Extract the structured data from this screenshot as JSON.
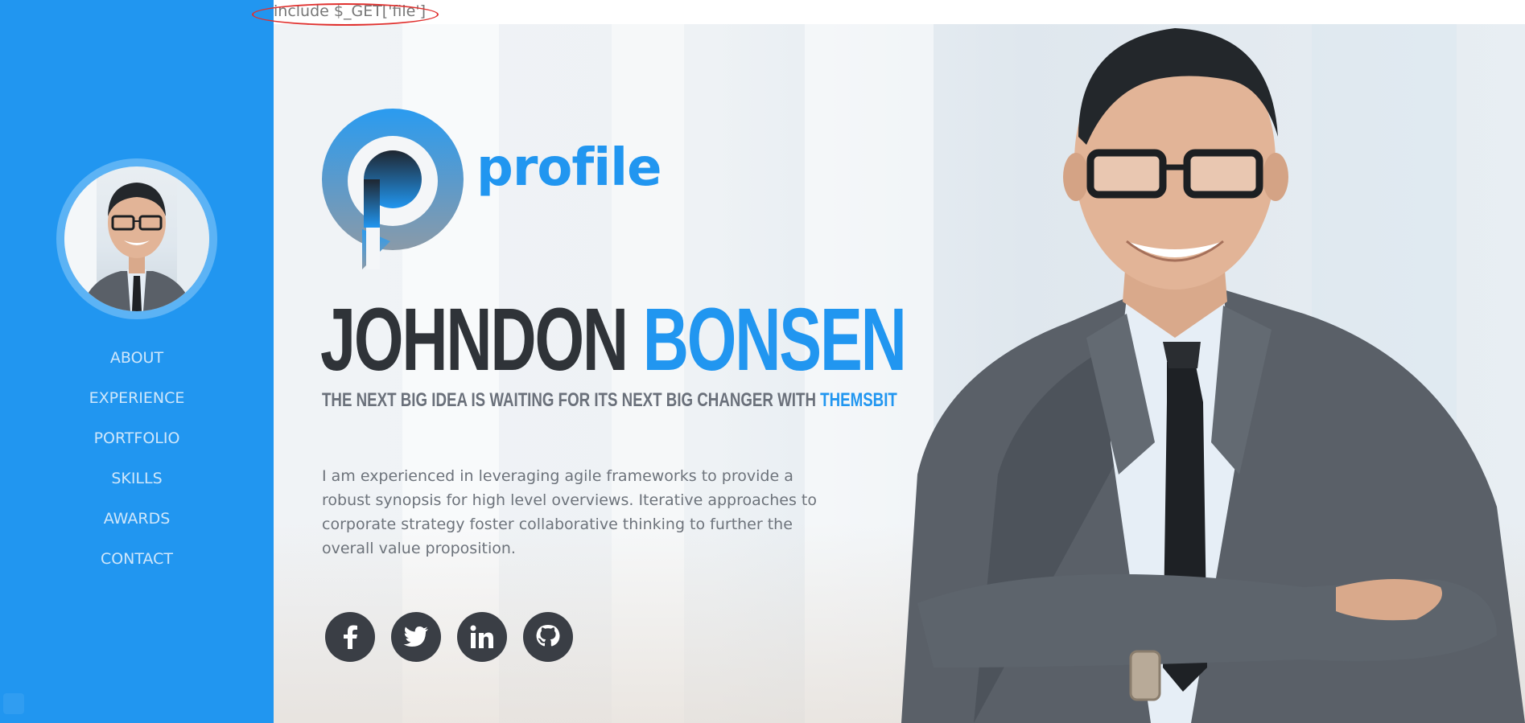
{
  "topbar": {
    "code_text": "include $_GET['file']"
  },
  "sidebar": {
    "nav": [
      {
        "label": "ABOUT"
      },
      {
        "label": "EXPERIENCE"
      },
      {
        "label": "PORTFOLIO"
      },
      {
        "label": "SKILLS"
      },
      {
        "label": "AWARDS"
      },
      {
        "label": "CONTACT"
      }
    ]
  },
  "hero": {
    "logo_word": "profile",
    "name_first": "JOHNDON",
    "name_last": "BONSEN",
    "tagline_prefix": "THE NEXT BIG IDEA IS WAITING FOR ITS NEXT BIG CHANGER WITH",
    "tagline_brand": "THEMSBIT",
    "bio_lines": [
      "I am experienced in leveraging agile frameworks to provide a",
      "robust synopsis for high level overviews. Iterative approaches to",
      "corporate strategy foster collaborative thinking to further the",
      "overall value proposition."
    ],
    "social": [
      {
        "icon": "facebook-icon"
      },
      {
        "icon": "twitter-icon"
      },
      {
        "icon": "linkedin-icon"
      },
      {
        "icon": "github-icon"
      }
    ]
  },
  "colors": {
    "accent": "#2196f0",
    "dark": "#2f3338",
    "muted": "#6d737b",
    "highlight": "#e0312f"
  }
}
